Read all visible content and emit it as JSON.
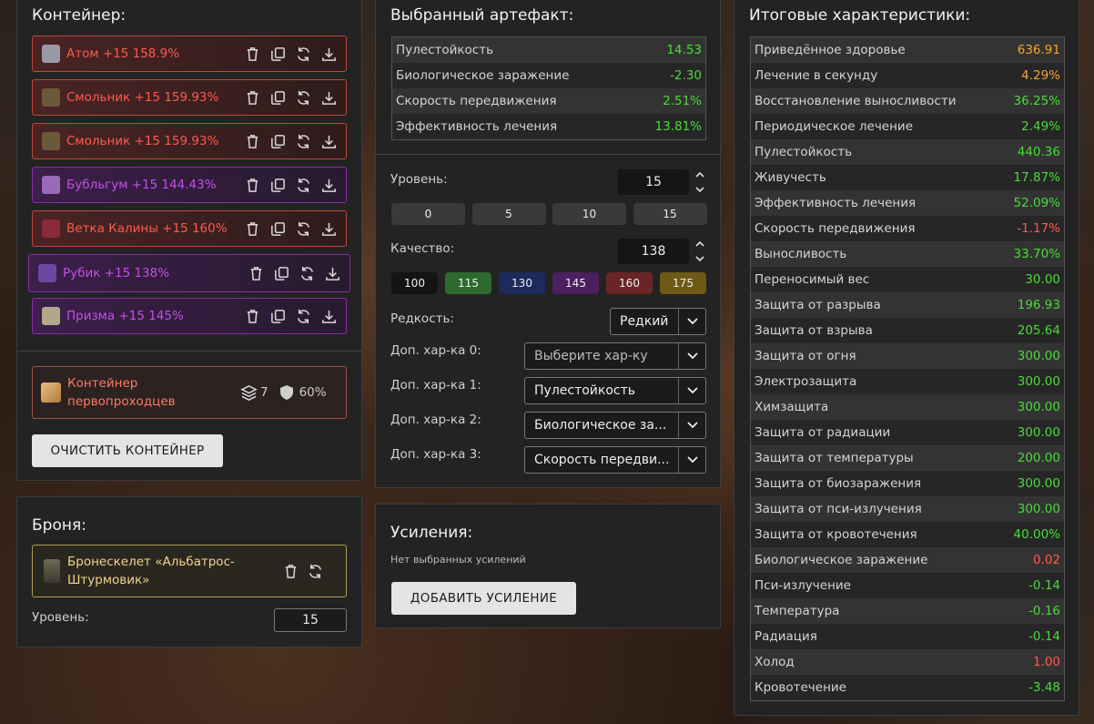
{
  "container": {
    "title": "Контейнер:",
    "items": [
      {
        "label": "Атом +15 158.9%",
        "variant": "red",
        "icon": "atom-icon"
      },
      {
        "label": "Смольник +15 159.93%",
        "variant": "red",
        "icon": "resin-icon"
      },
      {
        "label": "Смольник +15 159.93%",
        "variant": "red",
        "icon": "resin-icon"
      },
      {
        "label": "Бубльгум +15 144.43%",
        "variant": "purple",
        "icon": "bubblegum-icon"
      },
      {
        "label": "Ветка Калины +15 160%",
        "variant": "red",
        "icon": "viburnum-icon"
      },
      {
        "label": "Рубик +15 138%",
        "variant": "purple",
        "icon": "rubik-icon"
      },
      {
        "label": "Призма +15 145%",
        "variant": "purple",
        "icon": "prism-icon"
      }
    ],
    "selected": {
      "name": "Контейнер первопроходцев",
      "slots": "7",
      "protection": "60%"
    },
    "clear_button": "ОЧИСТИТЬ КОНТЕЙНЕР"
  },
  "armor": {
    "title": "Броня:",
    "name": "Бронескелет «Альбатрос-Штурмовик»",
    "level_label": "Уровень:",
    "level_value": "15"
  },
  "artifact": {
    "title": "Выбранный артефакт:",
    "stats": [
      {
        "name": "Пулестойкость",
        "value": "14.53",
        "color": "green"
      },
      {
        "name": "Биологическое заражение",
        "value": "-2.30",
        "color": "green"
      },
      {
        "name": "Скорость передвижения",
        "value": "2.51%",
        "color": "green"
      },
      {
        "name": "Эффективность лечения",
        "value": "13.81%",
        "color": "green"
      }
    ],
    "level_label": "Уровень:",
    "level_value": "15",
    "level_presets": [
      "0",
      "5",
      "10",
      "15"
    ],
    "quality_label": "Качество:",
    "quality_value": "138",
    "quality_presets": [
      {
        "label": "100",
        "bg": "#141414"
      },
      {
        "label": "115",
        "bg": "#2e6a2e"
      },
      {
        "label": "130",
        "bg": "#1e2a5c"
      },
      {
        "label": "145",
        "bg": "#4c1f5e"
      },
      {
        "label": "160",
        "bg": "#6a2626"
      },
      {
        "label": "175",
        "bg": "#6e5a16"
      }
    ],
    "rarity_label": "Редкость:",
    "rarity_value": "Редкий",
    "extra": [
      {
        "label": "Доп. хар-ка 0:",
        "value": "Выберите хар-ку"
      },
      {
        "label": "Доп. хар-ка 1:",
        "value": "Пулестойкость"
      },
      {
        "label": "Доп. хар-ка 2:",
        "value": "Биологическое за..."
      },
      {
        "label": "Доп. хар-ка 3:",
        "value": "Скорость передви..."
      }
    ]
  },
  "boosts": {
    "title": "Усиления:",
    "empty_text": "Нет выбранных усилений",
    "add_button": "ДОБАВИТЬ УСИЛЕНИЕ"
  },
  "totals": {
    "title": "Итоговые характеристики:",
    "stats": [
      {
        "name": "Приведённое здоровье",
        "value": "636.91",
        "color": "orange"
      },
      {
        "name": "Лечение в секунду",
        "value": "4.29%",
        "color": "orange"
      },
      {
        "name": "Восстановление выносливости",
        "value": "36.25%",
        "color": "green"
      },
      {
        "name": "Периодическое лечение",
        "value": "2.49%",
        "color": "green"
      },
      {
        "name": "Пулестойкость",
        "value": "440.36",
        "color": "green"
      },
      {
        "name": "Живучесть",
        "value": "17.87%",
        "color": "green"
      },
      {
        "name": "Эффективность лечения",
        "value": "52.09%",
        "color": "green"
      },
      {
        "name": "Скорость передвижения",
        "value": "-1.17%",
        "color": "red"
      },
      {
        "name": "Выносливость",
        "value": "33.70%",
        "color": "green"
      },
      {
        "name": "Переносимый вес",
        "value": "30.00",
        "color": "green"
      },
      {
        "name": "Защита от разрыва",
        "value": "196.93",
        "color": "green"
      },
      {
        "name": "Защита от взрыва",
        "value": "205.64",
        "color": "green"
      },
      {
        "name": "Защита от огня",
        "value": "300.00",
        "color": "green"
      },
      {
        "name": "Электрозащита",
        "value": "300.00",
        "color": "green"
      },
      {
        "name": "Химзащита",
        "value": "300.00",
        "color": "green"
      },
      {
        "name": "Защита от радиации",
        "value": "300.00",
        "color": "green"
      },
      {
        "name": "Защита от температуры",
        "value": "200.00",
        "color": "green"
      },
      {
        "name": "Защита от биозаражения",
        "value": "300.00",
        "color": "green"
      },
      {
        "name": "Защита от пси-излучения",
        "value": "300.00",
        "color": "green"
      },
      {
        "name": "Защита от кровотечения",
        "value": "40.00%",
        "color": "green"
      },
      {
        "name": "Биологическое заражение",
        "value": "0.02",
        "color": "red"
      },
      {
        "name": "Пси-излучение",
        "value": "-0.14",
        "color": "green"
      },
      {
        "name": "Температура",
        "value": "-0.16",
        "color": "green"
      },
      {
        "name": "Радиация",
        "value": "-0.14",
        "color": "green"
      },
      {
        "name": "Холод",
        "value": "1.00",
        "color": "red"
      },
      {
        "name": "Кровотечение",
        "value": "-3.48",
        "color": "green"
      }
    ]
  }
}
